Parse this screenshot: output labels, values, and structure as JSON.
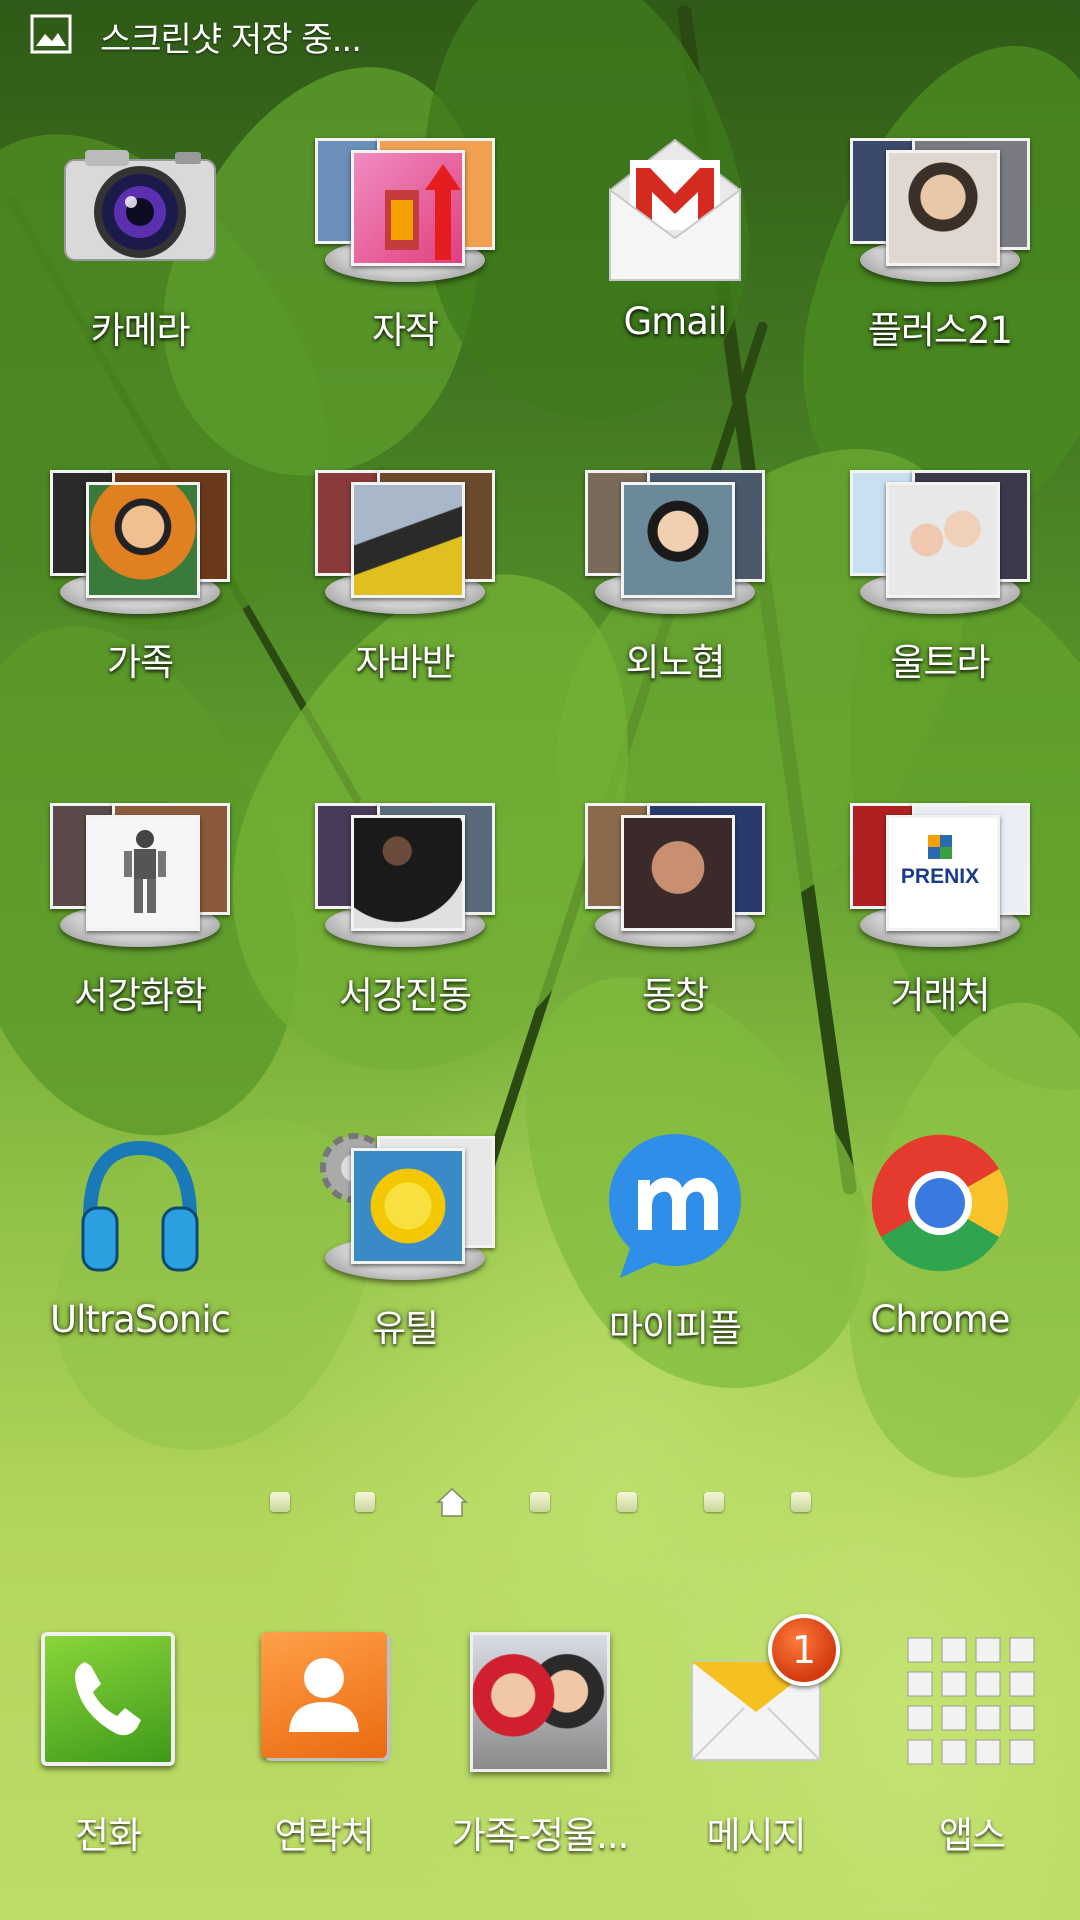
{
  "status_bar": {
    "notification_icon": "gallery-icon",
    "text": "스크린샷 저장 중..."
  },
  "home_grid": [
    [
      {
        "label": "카메라",
        "icon": "camera-icon",
        "type": "app"
      },
      {
        "label": "자작",
        "icon": "folder-icon",
        "type": "folder"
      },
      {
        "label": "Gmail",
        "icon": "gmail-icon",
        "type": "app"
      },
      {
        "label": "플러스21",
        "icon": "folder-icon",
        "type": "folder"
      }
    ],
    [
      {
        "label": "가족",
        "icon": "folder-icon",
        "type": "folder"
      },
      {
        "label": "자바반",
        "icon": "folder-icon",
        "type": "folder"
      },
      {
        "label": "외노협",
        "icon": "folder-icon",
        "type": "folder"
      },
      {
        "label": "울트라",
        "icon": "folder-icon",
        "type": "folder"
      }
    ],
    [
      {
        "label": "서강화학",
        "icon": "folder-icon",
        "type": "folder"
      },
      {
        "label": "서강진동",
        "icon": "folder-icon",
        "type": "folder"
      },
      {
        "label": "동창",
        "icon": "folder-icon",
        "type": "folder"
      },
      {
        "label": "거래처",
        "icon": "folder-icon",
        "type": "folder",
        "logo_text": "PRENIX"
      }
    ],
    [
      {
        "label": "UltraSonic",
        "icon": "headphones-icon",
        "type": "app"
      },
      {
        "label": "유틸",
        "icon": "folder-icon",
        "type": "folder"
      },
      {
        "label": "마이피플",
        "icon": "mypeople-icon",
        "type": "app"
      },
      {
        "label": "Chrome",
        "icon": "chrome-icon",
        "type": "app"
      }
    ]
  ],
  "page_indicator": {
    "pages": 7,
    "current": 3,
    "current_icon": "home-icon"
  },
  "dock": [
    {
      "label": "전화",
      "icon": "phone-icon"
    },
    {
      "label": "연락처",
      "icon": "contacts-icon"
    },
    {
      "label": "가족-정울...",
      "icon": "contact-photo-icon"
    },
    {
      "label": "메시지",
      "icon": "messages-icon",
      "badge": "1"
    },
    {
      "label": "앱스",
      "icon": "apps-grid-icon"
    }
  ],
  "colors": {
    "wallpaper_dark": "#2f5a17",
    "wallpaper_light": "#bcdc66",
    "badge": "#e0501a",
    "phone_green": "#5fb82a",
    "contacts_orange": "#f07a20"
  }
}
